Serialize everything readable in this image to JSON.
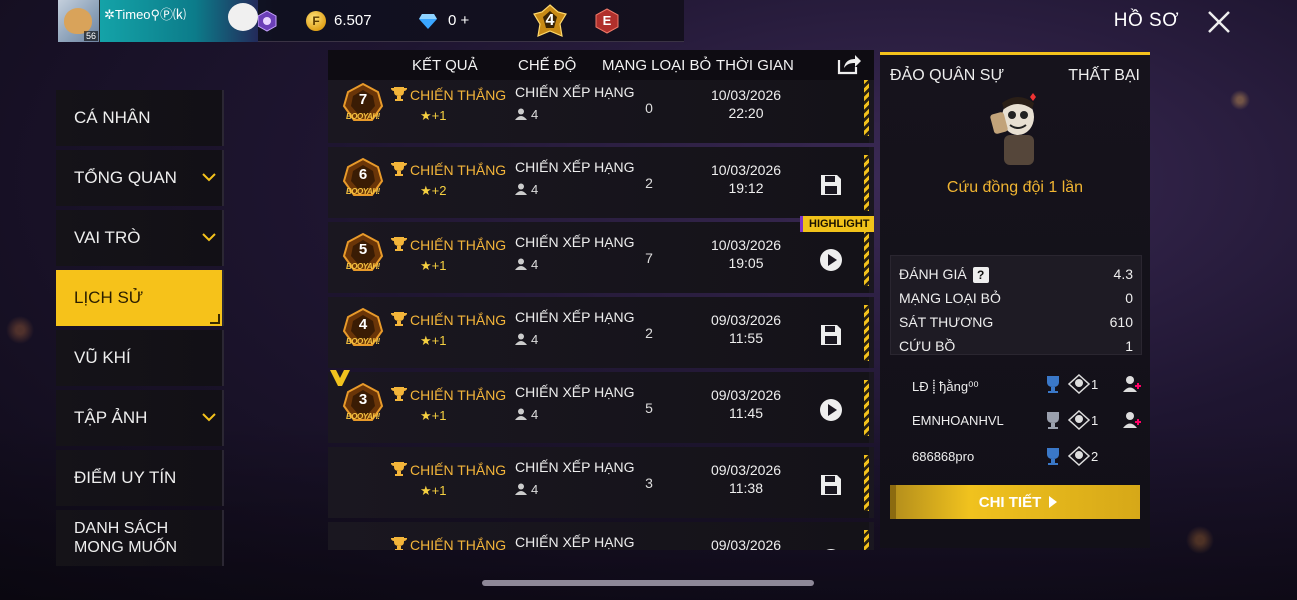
{
  "player": {
    "name": "✲Timeo⚲Ⓟ⒦",
    "level": "56",
    "gold": "6.507",
    "diamonds": "0 +",
    "rank_number": "4",
    "e_badge": "E"
  },
  "header": {
    "title": "HỒ SƠ"
  },
  "sidebar": {
    "items": [
      {
        "label": "CÁ NHÂN",
        "has_chevron": false
      },
      {
        "label": "TỔNG QUAN",
        "has_chevron": true
      },
      {
        "label": "VAI TRÒ",
        "has_chevron": true
      },
      {
        "label": "LỊCH SỬ",
        "has_chevron": false,
        "active": true
      },
      {
        "label": "VŨ KHÍ",
        "has_chevron": false
      },
      {
        "label": "TẬP ẢNH",
        "has_chevron": true
      },
      {
        "label": "ĐIỂM UY TÍN",
        "has_chevron": false
      },
      {
        "label": "DANH SÁCH MONG MUỐN",
        "line1": "DANH SÁCH",
        "line2": "MONG MUỐN",
        "has_chevron": false
      }
    ]
  },
  "table": {
    "headers": {
      "result": "KẾT QUẢ",
      "mode": "CHẾ ĐỘ",
      "kills": "MẠNG LOẠI BỎ",
      "time": "THỜI GIAN"
    },
    "rows": [
      {
        "rank": "7",
        "booyah": "BOOYAH!",
        "result": "CHIẾN THẮNG",
        "stars": "+1",
        "mode": "CHIẾN XẾP HẠNG",
        "players": "4",
        "kills": "0",
        "date": "10/03/2026",
        "clock": "22:20",
        "action": "none"
      },
      {
        "rank": "6",
        "booyah": "BOOYAH!",
        "result": "CHIẾN THẮNG",
        "stars": "+2",
        "mode": "CHIẾN XẾP HẠNG",
        "players": "4",
        "kills": "2",
        "date": "10/03/2026",
        "clock": "19:12",
        "action": "save"
      },
      {
        "rank": "5",
        "booyah": "BOOYAH!",
        "result": "CHIẾN THẮNG",
        "stars": "+1",
        "mode": "CHIẾN XẾP HẠNG",
        "players": "4",
        "kills": "7",
        "date": "10/03/2026",
        "clock": "19:05",
        "action": "play",
        "tag": "HIGHLIGHT"
      },
      {
        "rank": "4",
        "booyah": "BOOYAH!",
        "result": "CHIẾN THẮNG",
        "stars": "+1",
        "mode": "CHIẾN XẾP HẠNG",
        "players": "4",
        "kills": "2",
        "date": "09/03/2026",
        "clock": "11:55",
        "action": "save"
      },
      {
        "rank": "3",
        "booyah": "BOOYAH!",
        "result": "CHIẾN THẮNG",
        "stars": "+1",
        "mode": "CHIẾN XẾP HẠNG",
        "players": "4",
        "kills": "5",
        "date": "09/03/2026",
        "clock": "11:45",
        "action": "play",
        "mvp": true
      },
      {
        "rank": "",
        "booyah": "",
        "result": "CHIẾN THẮNG",
        "stars": "+1",
        "mode": "CHIẾN XẾP HẠNG",
        "players": "4",
        "kills": "3",
        "date": "09/03/2026",
        "clock": "11:38",
        "action": "save"
      },
      {
        "rank": "",
        "booyah": "",
        "result": "CHIẾN THẮNG",
        "stars": "",
        "mode": "CHIẾN XẾP HẠNG",
        "players": "",
        "kills": "",
        "date": "09/03/2026",
        "clock": "",
        "action": "play"
      }
    ]
  },
  "detail": {
    "map": "ĐẢO QUÂN SỰ",
    "result": "THẤT BẠI",
    "rescue_text": "Cứu đồng đội 1 lần",
    "stats": [
      {
        "label": "ĐÁNH GIÁ",
        "value": "4.3",
        "help": "?"
      },
      {
        "label": "MẠNG LOẠI BỎ",
        "value": "0"
      },
      {
        "label": "SÁT THƯƠNG",
        "value": "610"
      },
      {
        "label": "CỨU BỒ",
        "value": "1"
      }
    ],
    "team": [
      {
        "name": "LĐ ⸽ ђằng⁰⁰",
        "kills": "1",
        "can_add": true
      },
      {
        "name": "EMNHOANHVL",
        "kills": "1",
        "can_add": true
      },
      {
        "name": "686868pro",
        "kills": "2",
        "can_add": false
      }
    ],
    "detail_button": "CHI TIẾT"
  },
  "colors": {
    "accent": "#f4c21c",
    "win": "#f3b53a",
    "panel": "#16131c"
  }
}
